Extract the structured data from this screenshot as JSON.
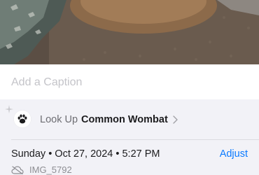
{
  "caption": {
    "placeholder": "Add a Caption"
  },
  "lookup": {
    "prefix": "Look Up",
    "subject": "Common Wombat",
    "icon": "paw-icon"
  },
  "details": {
    "date": "Sunday • Oct 27, 2024 • 5:27 PM",
    "adjust_label": "Adjust",
    "filename": "IMG_5792",
    "file_icon": "cloud-off-icon"
  },
  "colors": {
    "accent": "#0a7aff",
    "background": "#f2f2f7"
  }
}
